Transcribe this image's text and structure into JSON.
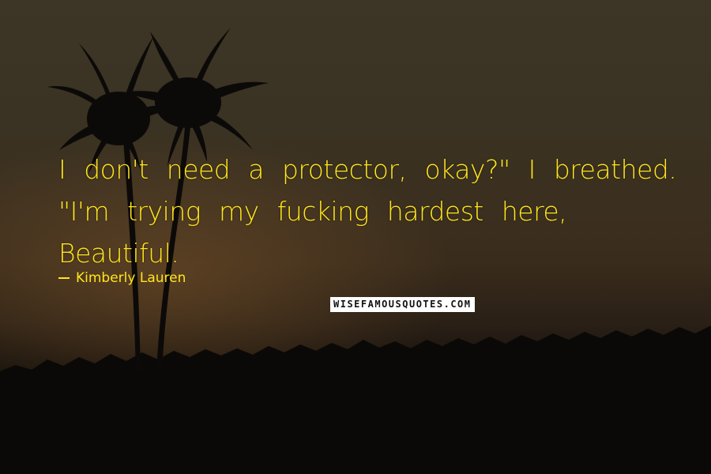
{
  "quote": {
    "text": "I don't need a protector, okay?\" I breathed. \"I'm trying my fucking hardest here, Beautiful."
  },
  "author": {
    "name": "Kimberly Lauren"
  },
  "watermark": {
    "text": "WISEFAMOUSQUOTES.COM"
  },
  "colors": {
    "text": "#ffe61c",
    "sky": "#3a3222",
    "ground": "#0e0b08"
  }
}
